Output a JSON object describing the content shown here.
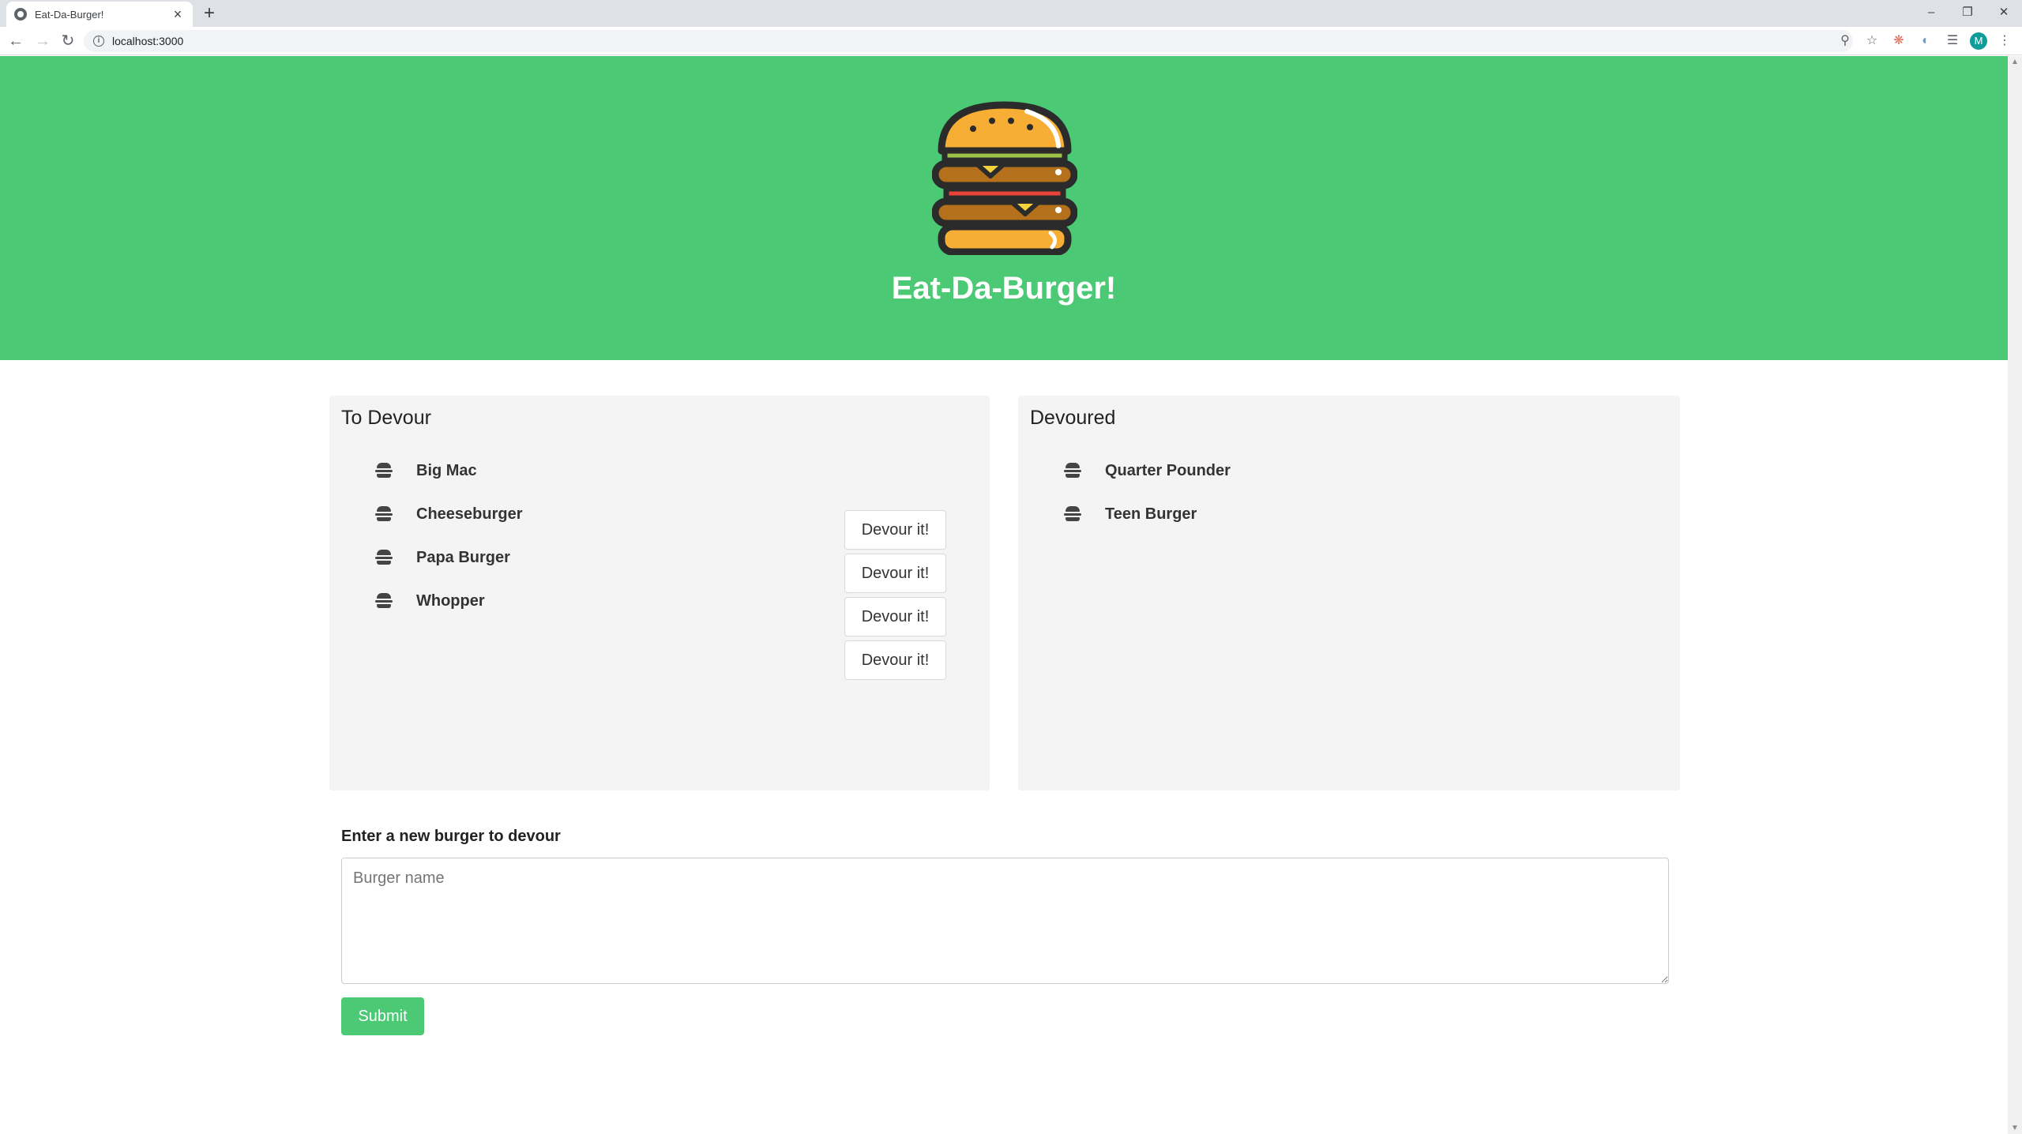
{
  "browser": {
    "tab_title": "Eat-Da-Burger!",
    "tab_close": "×",
    "new_tab": "+",
    "url": "localhost:3000",
    "avatar_letter": "M",
    "window_controls": [
      "–",
      "❐",
      "✕"
    ]
  },
  "header": {
    "title": "Eat-Da-Burger!",
    "background_color": "#4bc975"
  },
  "to_devour": {
    "title": "To Devour",
    "button_label": "Devour it!",
    "items": [
      "Big Mac",
      "Cheeseburger",
      "Papa Burger",
      "Whopper"
    ]
  },
  "devoured": {
    "title": "Devoured",
    "items": [
      "Quarter Pounder",
      "Teen Burger"
    ]
  },
  "form": {
    "label": "Enter a new burger to devour",
    "placeholder": "Burger name",
    "submit_label": "Submit"
  }
}
